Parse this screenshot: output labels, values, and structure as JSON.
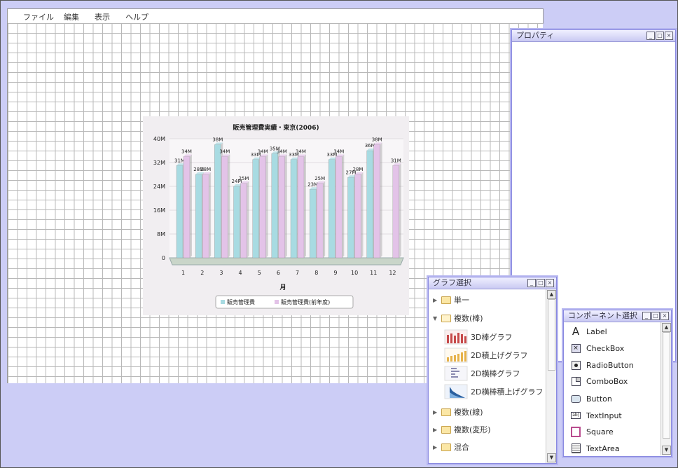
{
  "menu": [
    "ファイル",
    "編集",
    "表示",
    "ヘルプ"
  ],
  "properties_panel": {
    "title": "プロパティ"
  },
  "graph_panel": {
    "title": "グラフ選択",
    "tree": [
      {
        "label": "単一",
        "expanded": false
      },
      {
        "label": "複数(棒)",
        "expanded": true,
        "children": [
          "3D棒グラフ",
          "2D積上げグラフ",
          "2D横棒グラフ",
          "2D横棒積上げグラフ"
        ]
      },
      {
        "label": "複数(線)",
        "expanded": false
      },
      {
        "label": "複数(変形)",
        "expanded": false
      },
      {
        "label": "混合",
        "expanded": false
      }
    ]
  },
  "component_panel": {
    "title": "コンポーネント選択",
    "items": [
      {
        "label": "Label",
        "icon": "label-a-icon"
      },
      {
        "label": "CheckBox",
        "icon": "checkbox-icon"
      },
      {
        "label": "RadioButton",
        "icon": "radiobutton-icon"
      },
      {
        "label": "ComboBox",
        "icon": "combobox-icon"
      },
      {
        "label": "Button",
        "icon": "button-icon"
      },
      {
        "label": "TextInput",
        "icon": "textinput-icon"
      },
      {
        "label": "Square",
        "icon": "square-icon"
      },
      {
        "label": "TextArea",
        "icon": "textarea-icon"
      }
    ]
  },
  "chart_data": {
    "type": "bar",
    "title": "販売管理費実績・東京(2006)",
    "xlabel": "月",
    "ylabel": "",
    "categories": [
      "1",
      "2",
      "3",
      "4",
      "5",
      "6",
      "7",
      "8",
      "9",
      "10",
      "11",
      "12"
    ],
    "yticks": [
      "0",
      "8M",
      "16M",
      "24M",
      "32M",
      "40M"
    ],
    "ylim": [
      0,
      40
    ],
    "series": [
      {
        "name": "販売管理費",
        "color": "#a8dbe2",
        "values": [
          31,
          28,
          38,
          24,
          33,
          35,
          33,
          23,
          33,
          27,
          36,
          null
        ],
        "labels": [
          "31M",
          "28M",
          "38M",
          "24M",
          "33M",
          "35M",
          "33M",
          "23M",
          "33M",
          "27M",
          "36M",
          ""
        ]
      },
      {
        "name": "販売管理費(前年度)",
        "color": "#e3c3e8",
        "values": [
          34,
          28,
          34,
          25,
          34,
          34,
          34,
          25,
          34,
          28,
          38,
          31
        ],
        "labels": [
          "34M",
          "28M",
          "34M",
          "25M",
          "34M",
          "34M",
          "34M",
          "25M",
          "34M",
          "28M",
          "38M",
          "31M"
        ]
      }
    ],
    "legend": "bottom"
  },
  "colors": {
    "background": "#cccdf6",
    "panel_border": "#8a8ae0"
  }
}
